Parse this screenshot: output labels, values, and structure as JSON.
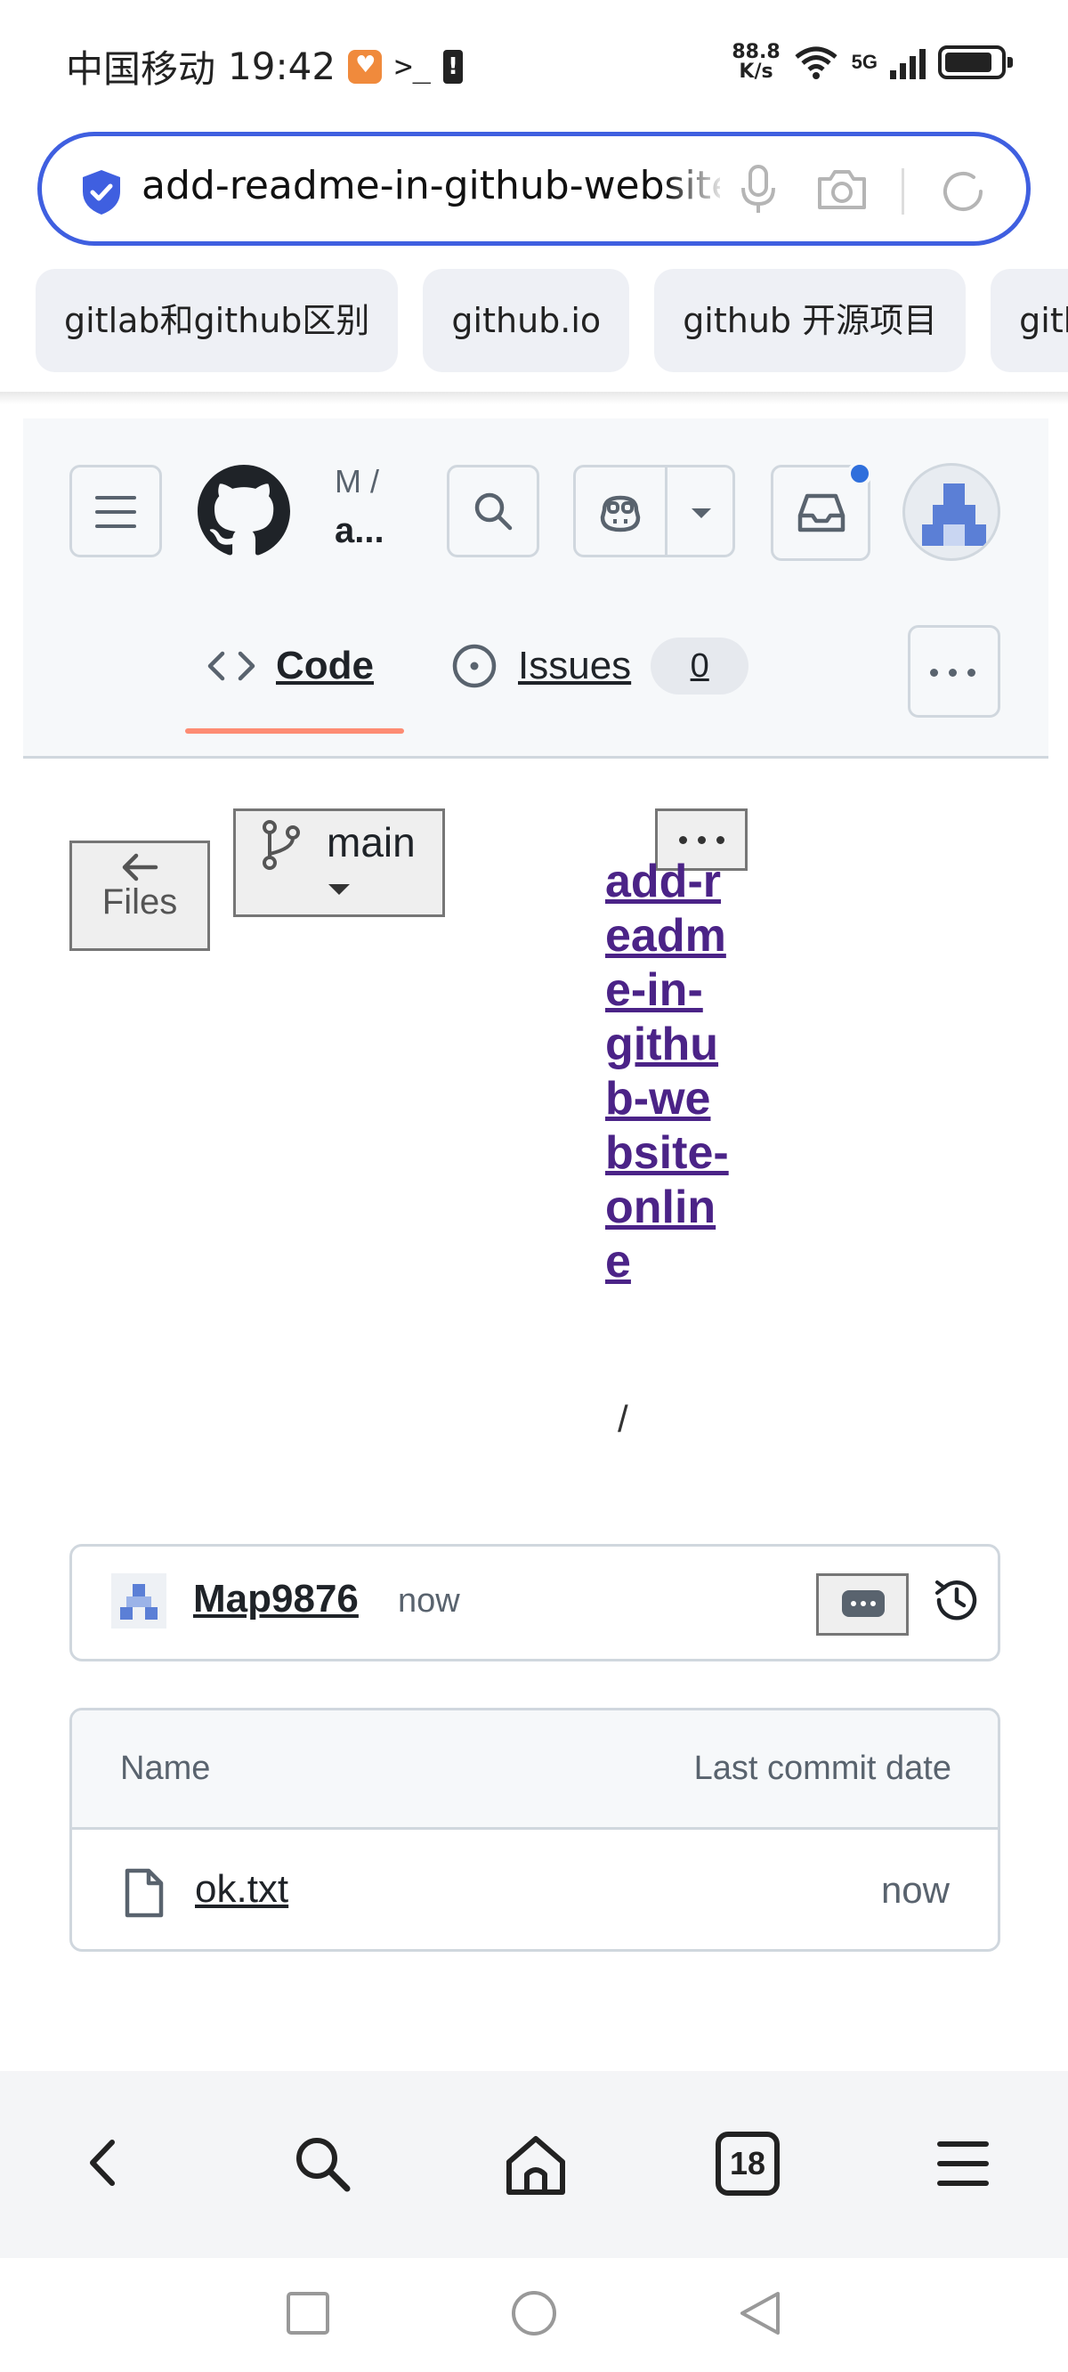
{
  "status_bar": {
    "carrier": "中国移动",
    "time": "19:42",
    "terminal": ">_",
    "net_speed_value": "88.8",
    "net_speed_unit": "K/s",
    "network_type": "5G",
    "icons": [
      "app-notification-icon",
      "terminal-icon",
      "alert-icon",
      "wifi-icon",
      "signal-icon",
      "battery-icon"
    ]
  },
  "address_bar": {
    "url": "add-readme-in-github-website-online",
    "icons": [
      "shield-icon",
      "mic-icon",
      "camera-icon",
      "reload-icon"
    ],
    "accent_color": "#3f5fe0"
  },
  "suggestions": [
    "gitlab和github区别",
    "github.io",
    "github 开源项目",
    "gith"
  ],
  "github_header": {
    "context_owner": "M /",
    "context_repo": "a...",
    "tabs": [
      {
        "label": "Code",
        "icon": "code-icon",
        "selected": true
      },
      {
        "label": "Issues",
        "icon": "issue-opened-icon",
        "count": "0"
      }
    ],
    "notification_dot_color": "#2f6fdc"
  },
  "file_view": {
    "files_button": "Files",
    "branch": "main",
    "breadcrumb_link": "add-readme-in-github-website-online",
    "breadcrumb_separator": "/"
  },
  "latest_commit": {
    "author": "Map9876",
    "time": "now"
  },
  "file_table": {
    "columns": [
      "Name",
      "Last commit date"
    ],
    "rows": [
      {
        "name": "ok.txt",
        "date": "now",
        "icon": "file-icon"
      }
    ]
  },
  "browser_nav": {
    "tab_count": "18",
    "icons": [
      "back-icon",
      "search-icon",
      "home-icon",
      "tabs-icon",
      "menu-icon"
    ]
  }
}
